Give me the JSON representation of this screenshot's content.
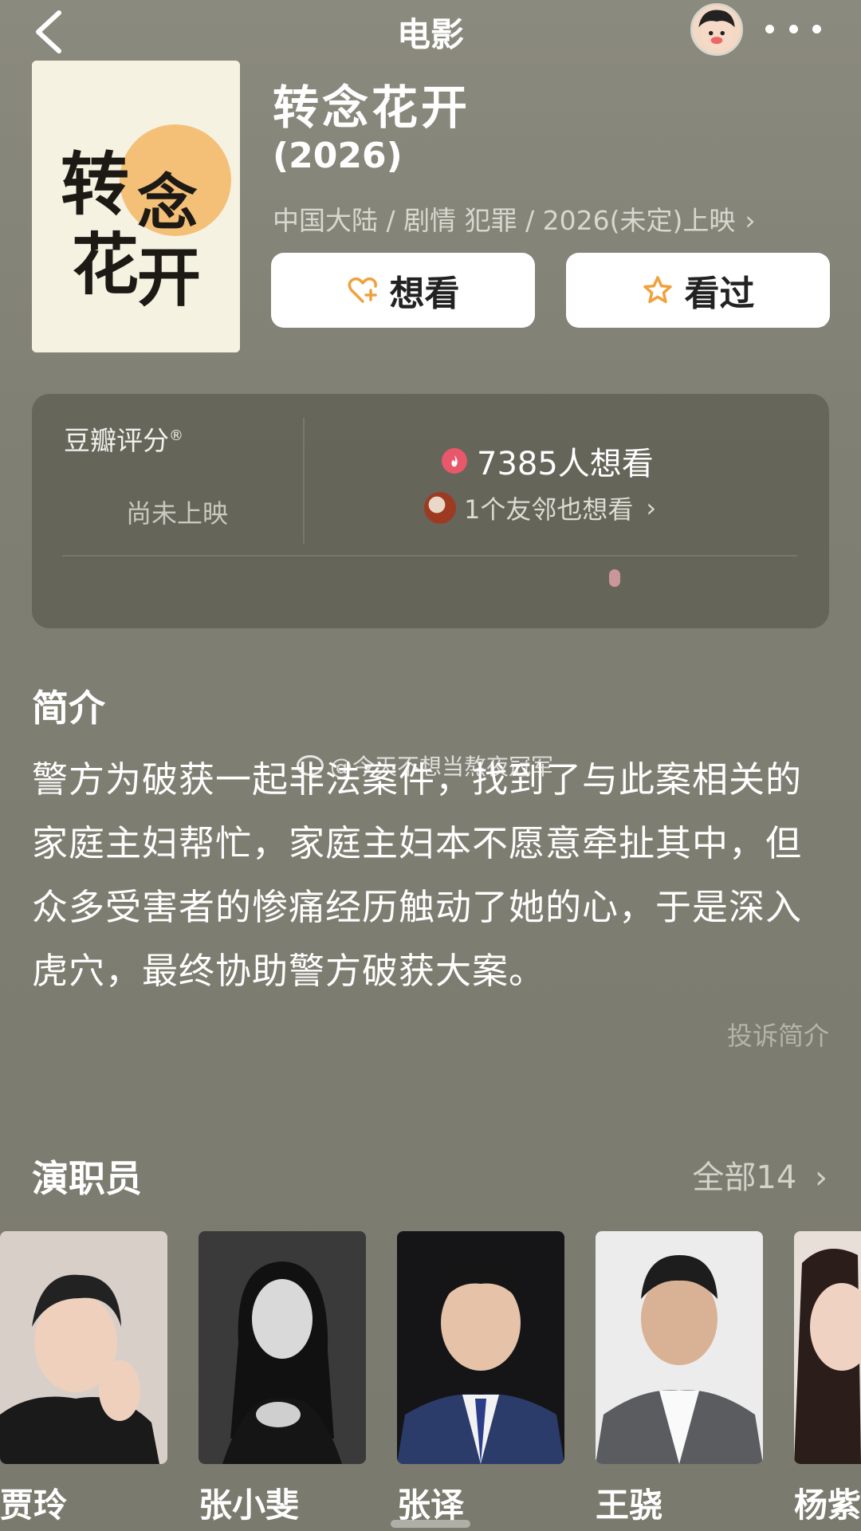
{
  "topbar": {
    "title": "电影"
  },
  "movie": {
    "title": "转念花开",
    "year": "(2026)",
    "meta": "中国大陆 / 剧情 犯罪 / 2026(未定)上映",
    "meta_chevron": "›",
    "poster_calligraphy": [
      "转",
      "念",
      "花",
      "开"
    ]
  },
  "actions": {
    "want_label": "想看",
    "seen_label": "看过"
  },
  "rating": {
    "label": "豆瓣评分",
    "registered": "®",
    "status": "尚未上映",
    "want_count": "7385人想看",
    "friends_text": "1个友邻也想看",
    "chevron": "›"
  },
  "intro": {
    "title": "简介",
    "text": "警方为破获一起非法案件，找到了与此案相关的家庭主妇帮忙，家庭主妇本不愿意牵扯其中，但众多受害者的惨痛经历触动了她的心，于是深入虎穴，最终协助警方破获大案。",
    "report": "投诉简介",
    "watermark": "@今天不想当熬夜冠军"
  },
  "cast": {
    "title": "演职员",
    "all_label": "全部14",
    "chevron": "›",
    "members": [
      {
        "name": "贾玲"
      },
      {
        "name": "张小斐"
      },
      {
        "name": "张译"
      },
      {
        "name": "王骁"
      },
      {
        "name": "杨紫"
      }
    ]
  },
  "colors": {
    "background": "#7b7b6f",
    "want_icon": "#f0a13c",
    "star_icon": "#f0a13c",
    "flame": "#e8576a"
  }
}
